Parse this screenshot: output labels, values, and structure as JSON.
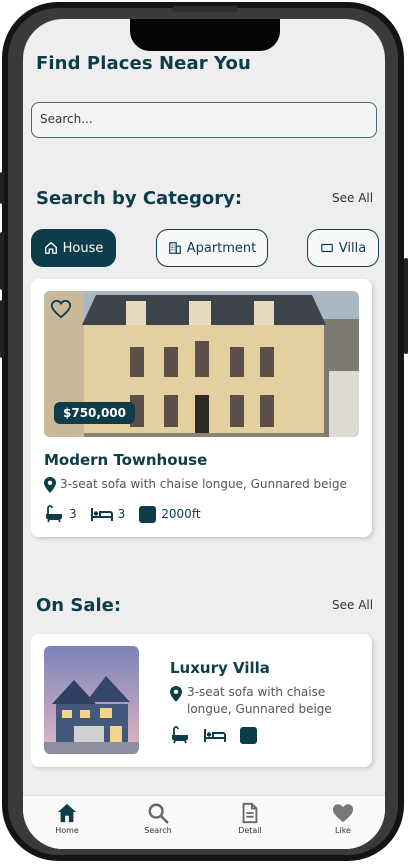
{
  "header": {
    "title": "Find Places Near You"
  },
  "search": {
    "placeholder": "Search..."
  },
  "categories": {
    "title": "Search by Category:",
    "see_all": "See All",
    "items": [
      {
        "label": "House",
        "icon": "house-icon",
        "active": true
      },
      {
        "label": "Apartment",
        "icon": "apartment-icon",
        "active": false
      },
      {
        "label": "Villa",
        "icon": "villa-icon",
        "active": false
      }
    ]
  },
  "featured": {
    "price": "$750,000",
    "title": "Modern Townhouse",
    "address": "3-seat sofa with chaise longue, Gunnared beige",
    "baths": "3",
    "beds": "3",
    "area": "2000ft"
  },
  "on_sale": {
    "title": "On Sale:",
    "see_all": "See All",
    "item": {
      "title": "Luxury Villa",
      "address_line1": "3-seat sofa with chaise",
      "address_line2": "longue, Gunnared beige"
    }
  },
  "tabbar": {
    "items": [
      {
        "label": "Home",
        "icon": "home-icon",
        "active": true
      },
      {
        "label": "Search",
        "icon": "search-icon",
        "active": false
      },
      {
        "label": "Detail",
        "icon": "document-icon",
        "active": false
      },
      {
        "label": "Like",
        "icon": "heart-icon",
        "active": false
      }
    ]
  },
  "colors": {
    "primary": "#0d3c4a",
    "background": "#eeeeee",
    "card": "#ffffff"
  }
}
